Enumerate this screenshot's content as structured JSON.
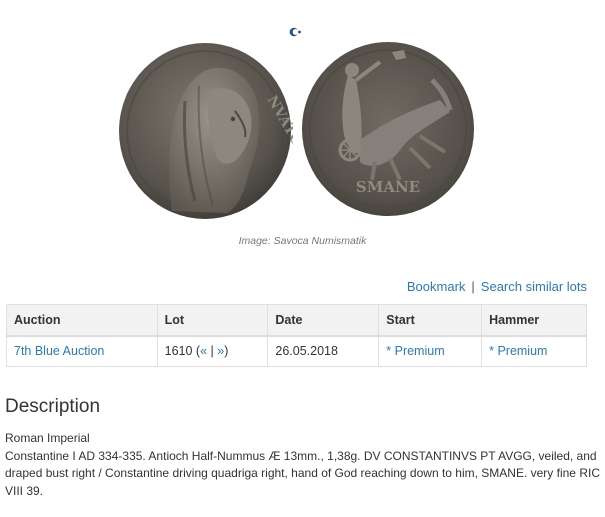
{
  "image": {
    "caption": "Image: Savoca Numismatik",
    "obverse_legend": "NVATC",
    "reverse_exergue": "SMANE",
    "coin_color": "#58544d"
  },
  "actions": {
    "bookmark_label": "Bookmark",
    "separator": "|",
    "similar_label": "Search similar lots"
  },
  "lot_table": {
    "headers": [
      "Auction",
      "Lot",
      "Date",
      "Start",
      "Hammer"
    ],
    "row": {
      "auction": "7th Blue Auction",
      "lot_number": "1610 (",
      "prev_label": "«",
      "divider": "|",
      "next_label": "»",
      "lot_close": ")",
      "date": "26.05.2018",
      "start": "* Premium",
      "hammer": "* Premium"
    }
  },
  "description": {
    "title": "Description",
    "category": "Roman Imperial",
    "text": "Constantine I AD 334-335. Antioch Half-Nummus Æ 13mm., 1,38g. DV CONSTANTINVS PT AVGG, veiled, and draped bust right / Constantine driving quadriga right, hand of God reaching down to him, SMANE. very fine RIC VIII 39."
  },
  "colors": {
    "link": "#2a7ab8",
    "text": "#333333",
    "header_bg": "#f2f2f2"
  }
}
